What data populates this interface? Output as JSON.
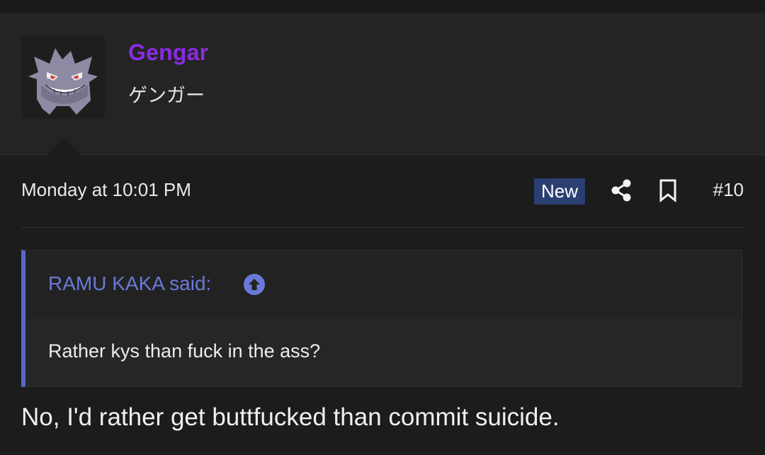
{
  "user": {
    "name": "Gengar",
    "title": "ゲンガー",
    "avatar_icon": "gengar-avatar"
  },
  "post": {
    "date": "Monday at 10:01 PM",
    "badge": "New",
    "share_icon": "share-icon",
    "bookmark_icon": "bookmark-icon",
    "number": "#10",
    "body": "No, I'd rather get buttfucked than commit suicide."
  },
  "quote": {
    "author": "RAMU KAKA said:",
    "arrow_icon": "arrow-up-circle-icon",
    "text": "Rather kys than fuck in the ass?"
  },
  "colors": {
    "username": "#8a2be2",
    "badge_bg": "#2b3f73",
    "quote_accent": "#5b67c8",
    "quote_author": "#6a79d8",
    "background": "#1c1c1c"
  }
}
